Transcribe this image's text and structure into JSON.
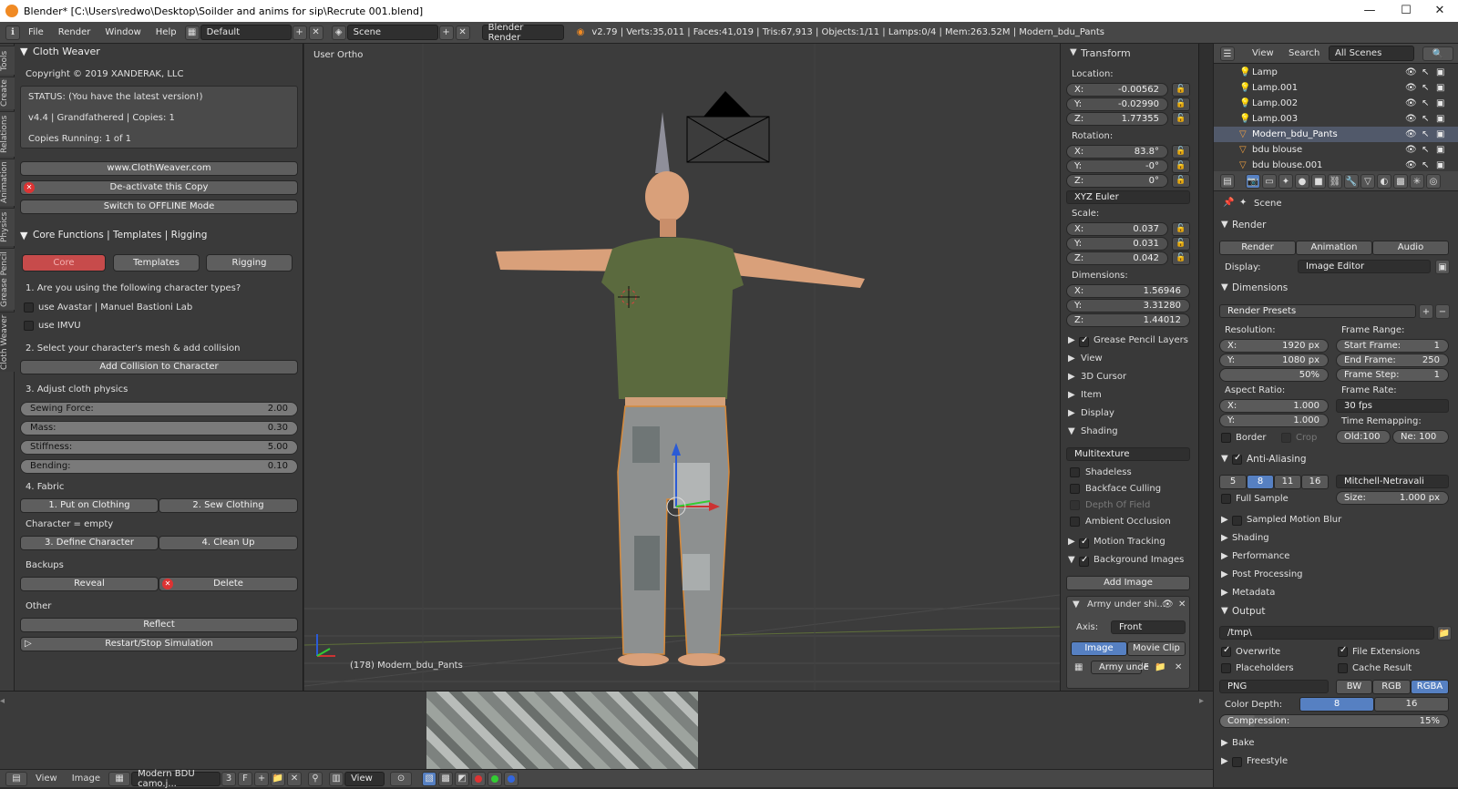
{
  "window": {
    "title": "Blender* [C:\\Users\\redwo\\Desktop\\Soilder and anims for sip\\Recrute 001.blend]",
    "minimize": "—",
    "maximize": "☐",
    "close": "✕"
  },
  "topbar": {
    "menus": [
      "File",
      "Render",
      "Window",
      "Help"
    ],
    "layout": "Default",
    "scene": "Scene",
    "engine": "Blender Render",
    "stats": "v2.79 | Verts:35,011 | Faces:41,019 | Tris:67,913 | Objects:1/11 | Lamps:0/4 | Mem:263.52M | Modern_bdu_Pants"
  },
  "tooltabs": [
    "Tools",
    "Create",
    "Relations",
    "Animation",
    "Physics",
    "Grease Pencil",
    "Cloth Weaver"
  ],
  "cloth_weaver": {
    "header": "Cloth Weaver",
    "copyright": "Copyright © 2019 XANDERAK, LLC",
    "status": "STATUS: (You have the latest version!)",
    "version": "v4.4 | Grandfathered | Copies: 1",
    "copies_running": "Copies Running: 1 of 1",
    "website_button": "www.ClothWeaver.com",
    "deactivate_button": "De-activate this Copy",
    "offline_button": "Switch to OFFLINE Mode",
    "core_header": "Core Functions | Templates | Rigging",
    "tabs": [
      "Core",
      "Templates",
      "Rigging"
    ],
    "q1": "1. Are you using the following character types?",
    "opt_avastar": "use Avastar | Manuel Bastioni Lab",
    "opt_imvu": "use IMVU",
    "q2": "2. Select your character's mesh & add collision",
    "collision_button": "Add Collision to Character",
    "q3": "3. Adjust cloth physics",
    "sliders": [
      {
        "label": "Sewing Force:",
        "value": "2.00"
      },
      {
        "label": "Mass:",
        "value": "0.30"
      },
      {
        "label": "Stiffness:",
        "value": "5.00"
      },
      {
        "label": "Bending:",
        "value": "0.10"
      }
    ],
    "q4": "4. Fabric",
    "put_on": "1. Put on Clothing",
    "sew": "2. Sew Clothing",
    "character": "Character = empty",
    "define": "3. Define Character",
    "cleanup": "4. Clean Up",
    "backups": "Backups",
    "reveal": "Reveal",
    "delete": "Delete",
    "other": "Other",
    "reflect": "Reflect",
    "restart": "Restart/Stop Simulation"
  },
  "viewport": {
    "label": "User Ortho",
    "object_label": "(178) Modern_bdu_Pants"
  },
  "transform": {
    "header": "Transform",
    "location_label": "Location:",
    "location": [
      {
        "axis": "X:",
        "value": "-0.00562"
      },
      {
        "axis": "Y:",
        "value": "-0.02990"
      },
      {
        "axis": "Z:",
        "value": "1.77355"
      }
    ],
    "rotation_label": "Rotation:",
    "rotation": [
      {
        "axis": "X:",
        "value": "83.8°"
      },
      {
        "axis": "Y:",
        "value": "-0°"
      },
      {
        "axis": "Z:",
        "value": "0°"
      }
    ],
    "rotation_mode": "XYZ Euler",
    "scale_label": "Scale:",
    "scale": [
      {
        "axis": "X:",
        "value": "0.037"
      },
      {
        "axis": "Y:",
        "value": "0.031"
      },
      {
        "axis": "Z:",
        "value": "0.042"
      }
    ],
    "dimensions_label": "Dimensions:",
    "dimensions": [
      {
        "axis": "X:",
        "value": "1.56946"
      },
      {
        "axis": "Y:",
        "value": "3.31280"
      },
      {
        "axis": "Z:",
        "value": "1.44012"
      }
    ],
    "sections": [
      "Grease Pencil Layers",
      "View",
      "3D Cursor",
      "Item",
      "Display"
    ],
    "shading_header": "Shading",
    "shading_mode": "Multitexture",
    "shading_opts": [
      "Shadeless",
      "Backface Culling",
      "Depth Of Field",
      "Ambient Occlusion"
    ],
    "motion_tracking": "Motion Tracking",
    "bg_images": "Background Images",
    "add_image": "Add Image",
    "bg_item": "Army under shi...",
    "axis_label": "Axis:",
    "axis_value": "Front",
    "image_tab": "Image",
    "movieclip_tab": "Movie Clip",
    "bg_item_short": "Army unde",
    "bg_item_f": "F"
  },
  "outliner": {
    "view": "View",
    "search": "Search",
    "scenes": "All Scenes",
    "items": [
      "Lamp",
      "Lamp.001",
      "Lamp.002",
      "Lamp.003",
      "Modern_bdu_Pants",
      "bdu blouse",
      "bdu blouse.001"
    ]
  },
  "properties": {
    "scene": "Scene",
    "render_header": "Render",
    "render_btns": [
      "Render",
      "Animation",
      "Audio"
    ],
    "display_label": "Display:",
    "display_value": "Image Editor",
    "dimensions_header": "Dimensions",
    "render_presets": "Render Presets",
    "resolution_label": "Resolution:",
    "res_x": {
      "label": "X:",
      "value": "1920 px"
    },
    "res_y": {
      "label": "Y:",
      "value": "1080 px"
    },
    "res_pct": "50%",
    "frame_range_label": "Frame Range:",
    "start": {
      "label": "Start Frame:",
      "value": "1"
    },
    "end": {
      "label": "End Frame:",
      "value": "250"
    },
    "step": {
      "label": "Frame Step:",
      "value": "1"
    },
    "aspect_label": "Aspect Ratio:",
    "asp_x": {
      "label": "X:",
      "value": "1.000"
    },
    "asp_y": {
      "label": "Y:",
      "value": "1.000"
    },
    "frame_rate_label": "Frame Rate:",
    "frame_rate": "30 fps",
    "time_remap": "Time Remapping:",
    "old": "Old:100",
    "new": "Ne: 100",
    "border": "Border",
    "crop": "Crop",
    "aa_header": "Anti-Aliasing",
    "aa_samples": [
      "5",
      "8",
      "11",
      "16"
    ],
    "aa_filter": "Mitchell-Netravali",
    "full_sample": "Full Sample",
    "size_label": "Size:",
    "size_value": "1.000 px",
    "sections": [
      "Sampled Motion Blur",
      "Shading",
      "Performance",
      "Post Processing",
      "Metadata"
    ],
    "output_header": "Output",
    "output_path": "/tmp\\",
    "overwrite": "Overwrite",
    "file_ext": "File Extensions",
    "placeholders": "Placeholders",
    "cache_result": "Cache Result",
    "format": "PNG",
    "color_modes": [
      "BW",
      "RGB",
      "RGBA"
    ],
    "color_depth_label": "Color Depth:",
    "depths": [
      "8",
      "16"
    ],
    "compression_label": "Compression:",
    "compression_value": "15%",
    "bake": "Bake",
    "freestyle": "Freestyle"
  },
  "image_editor": {
    "menus": [
      "View",
      "Image"
    ],
    "image_name": "Modern BDU camo.j...",
    "users": "3",
    "fake": "F",
    "view": "View"
  }
}
